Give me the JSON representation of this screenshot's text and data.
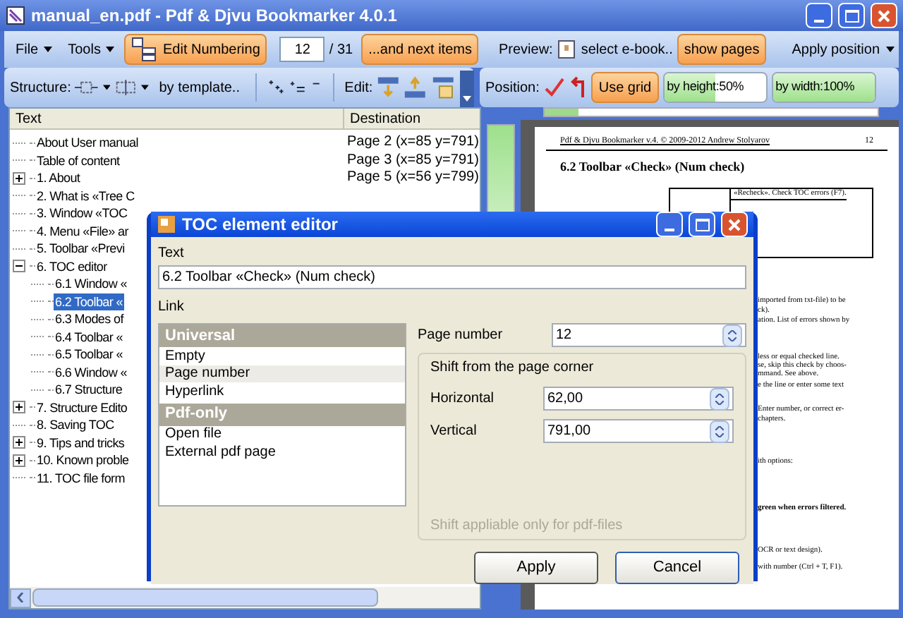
{
  "window": {
    "title": "manual_en.pdf - Pdf & Djvu Bookmarker 4.0.1"
  },
  "toolbar": {
    "menus": [
      "File",
      "Tools"
    ],
    "edit_numbering": "Edit Numbering",
    "page": "12",
    "page_total": "/ 31",
    "next_items": "...and next items",
    "preview_label": "Preview:",
    "select_ebook": "select e-book..",
    "show_pages": "show pages",
    "apply_position": "Apply position"
  },
  "toolbar2": {
    "structure_label": "Structure:",
    "by_template": "by template..",
    "edit_label": "Edit:",
    "position_label": "Position:",
    "use_grid": "Use grid",
    "meters": [
      {
        "label": "by height:50%",
        "level": 0.5
      },
      {
        "label": "by width:100%",
        "level": 1
      }
    ]
  },
  "tree": {
    "columns": [
      "Text",
      "Destination"
    ],
    "items": [
      {
        "text": "About User manual",
        "destination": "Page 2 (x=85 y=791)",
        "selected": false
      },
      {
        "text": "Table of content",
        "destination": "Page 3 (x=85 y=791)",
        "selected": false
      },
      {
        "text": "1. About",
        "destination": "Page 5 (x=56 y=799)",
        "expanded": false,
        "selected": false
      },
      {
        "text": "2. What is «Tree C",
        "selected": false
      },
      {
        "text": "3. Window «TOC",
        "selected": false
      },
      {
        "text": "4. Menu «File» ar",
        "selected": false
      },
      {
        "text": "5. Toolbar «Previ",
        "selected": false
      },
      {
        "text": "6. TOC editor",
        "expanded": true,
        "selected": false,
        "children": [
          {
            "text": "6.1 Window «",
            "selected": false
          },
          {
            "text": "6.2 Toolbar «",
            "selected": true
          },
          {
            "text": "6.3 Modes of",
            "selected": false
          },
          {
            "text": "6.4 Toolbar «",
            "selected": false
          },
          {
            "text": "6.5 Toolbar «",
            "selected": false
          },
          {
            "text": "6.6 Window «",
            "selected": false
          },
          {
            "text": "6.7 Structure",
            "selected": false
          }
        ]
      },
      {
        "text": "7. Structure Edito",
        "expanded": false,
        "selected": false
      },
      {
        "text": "8. Saving TOC",
        "selected": false
      },
      {
        "text": "9. Tips and tricks",
        "expanded": false,
        "selected": false
      },
      {
        "text": "10. Known proble",
        "expanded": false,
        "selected": false
      },
      {
        "text": "11. TOC file form",
        "selected": false
      }
    ]
  },
  "page_preview": {
    "header": "Pdf & Djvu Bookmarker v.4. © 2009-2012 Andrew Stolyarov",
    "page_number": "12",
    "heading": "6.2   Toolbar «Check» (Num check)",
    "table_cell": "«Recheck». Check TOC errors (F7).",
    "fragments": [
      {
        "text": "imported from txt-file) to be",
        "bold": false
      },
      {
        "text": "ck).",
        "bold": false
      },
      {
        "text": "ation. List of errors shown by",
        "bold": false
      },
      {
        "text": "less or equal checked line.",
        "bold": false
      },
      {
        "text": "se, skip this check by choos-",
        "bold": false
      },
      {
        "text": "mmand. See above.",
        "bold": false
      },
      {
        "text": "e the line or enter some text",
        "bold": false
      },
      {
        "text": "Enter number, or correct er-",
        "bold": false
      },
      {
        "text": "chapters.",
        "bold": false
      },
      {
        "text": "ith options:",
        "bold": false
      },
      {
        "text": "green when errors filtered.",
        "bold": true
      },
      {
        "text": "OCR or text design).",
        "bold": false
      },
      {
        "text": "with number (Ctrl + T, F1).",
        "bold": false
      }
    ]
  },
  "dialog": {
    "title": "TOC element editor",
    "text_label": "Text",
    "text_value": "6.2 Toolbar «Check» (Num check)",
    "link_label": "Link",
    "link_list": [
      {
        "kind": "group",
        "text": "Universal"
      },
      {
        "kind": "item",
        "text": "Empty",
        "selected": false
      },
      {
        "kind": "item",
        "text": "Page number",
        "selected": true
      },
      {
        "kind": "item",
        "text": "Hyperlink",
        "selected": false
      },
      {
        "kind": "group",
        "text": "Pdf-only"
      },
      {
        "kind": "item",
        "text": "Open file",
        "selected": false
      },
      {
        "kind": "item",
        "text": "External pdf page",
        "selected": false
      }
    ],
    "page_number_label": "Page number",
    "page_number": "12",
    "shift_group": "Shift from the page corner",
    "horizontal_label": "Horizontal",
    "horizontal": "62,00",
    "vertical_label": "Vertical",
    "vertical": "791,00",
    "note": "Shift appliable only for pdf-files",
    "buttons": [
      "Apply",
      "Cancel"
    ]
  }
}
